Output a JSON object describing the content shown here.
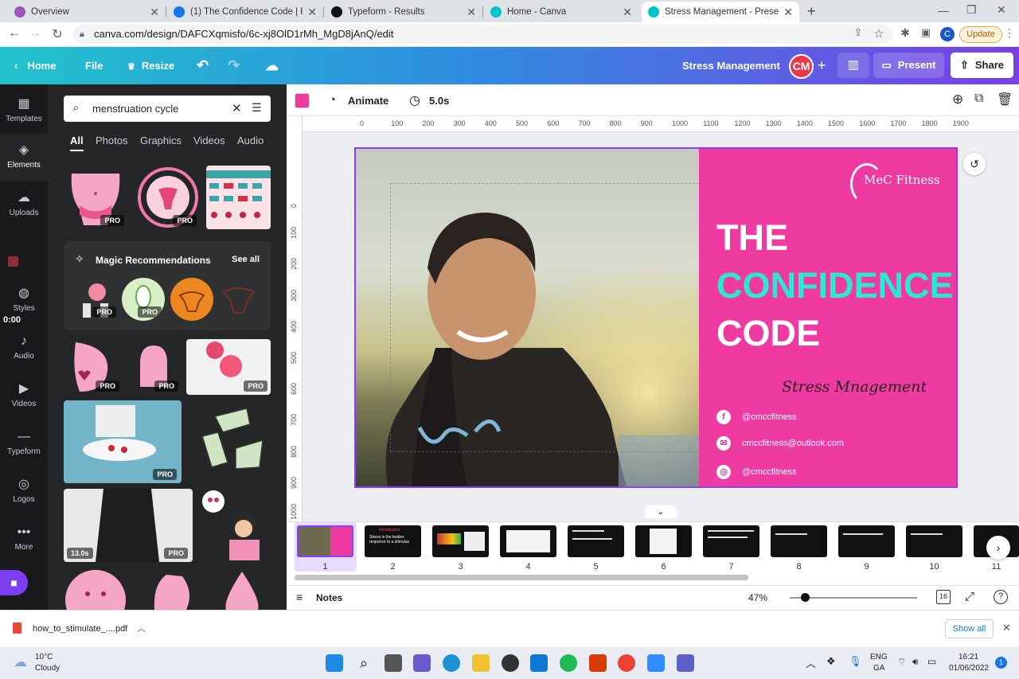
{
  "browser": {
    "tabs": [
      {
        "title": "Overview",
        "color": "#9b59b6"
      },
      {
        "title": "(1) The Confidence Code | Facebo",
        "color": "#1877f2"
      },
      {
        "title": "Typeform - Results",
        "color": "#111111"
      },
      {
        "title": "Home - Canva",
        "color": "#00c4cc"
      },
      {
        "title": "Stress Management - Presentatio",
        "color": "#00c4cc"
      }
    ],
    "url": "canva.com/design/DAFCXqmisfo/6c-xj8OlD1rMh_MgD8jAnQ/edit",
    "update_label": "Update",
    "profile_initial": "C"
  },
  "header": {
    "home": "Home",
    "file": "File",
    "resize": "Resize",
    "doc_title": "Stress Management",
    "avatar": "CM",
    "present": "Present",
    "share": "Share"
  },
  "rail": {
    "items": [
      "Templates",
      "Elements",
      "Uploads",
      "Styles",
      "Audio",
      "Videos",
      "Typeform",
      "Logos",
      "More"
    ],
    "timer": "0:00"
  },
  "panel": {
    "search_value": "menstruation cycle",
    "tabs": [
      "All",
      "Photos",
      "Graphics",
      "Videos",
      "Audio"
    ],
    "pro_badge": "PRO",
    "magic_title": "Magic Recommendations",
    "see_all": "See all",
    "video_duration": "13.0s"
  },
  "toolbar": {
    "animate": "Animate",
    "duration": "5.0s",
    "accent_color": "#ef3aa1"
  },
  "ruler": {
    "h": [
      "0",
      "100",
      "200",
      "300",
      "400",
      "500",
      "600",
      "700",
      "800",
      "900",
      "1000",
      "1100",
      "1200",
      "1300",
      "1400",
      "1500",
      "1600",
      "1700",
      "1800",
      "1900"
    ],
    "v": [
      "0",
      "100",
      "200",
      "300",
      "400",
      "500",
      "600",
      "700",
      "800",
      "900",
      "1000"
    ]
  },
  "slide": {
    "brand": "MeC Fitness",
    "title_line1": "THE",
    "title_line2": "CONFIDENCE",
    "title_line3": "CODE",
    "subtitle": "Stress Mnagement",
    "facebook": "@cmccfitness",
    "email": "cmccfitness@outlook.com",
    "instagram": "@cmccfitness",
    "pink": "#ef3aa1",
    "cyan": "#2ee6d6"
  },
  "pages": {
    "numbers": [
      "1",
      "2",
      "3",
      "4",
      "5",
      "6",
      "7",
      "8",
      "9",
      "10",
      "11"
    ],
    "page2_title": "Introduction",
    "page2_text": "Stress is the bodies response to a stimulus"
  },
  "footer": {
    "notes": "Notes",
    "zoom": "47%",
    "page_count": "16",
    "zoom_fraction": 0.12
  },
  "download": {
    "filename": "how_to_stimulate_....pdf",
    "show_all": "Show all"
  },
  "taskbar": {
    "temp": "10°C",
    "weather": "Cloudy",
    "lang1": "ENG",
    "lang2": "GA",
    "time": "16:21",
    "date": "01/06/2022",
    "notif": "1"
  }
}
